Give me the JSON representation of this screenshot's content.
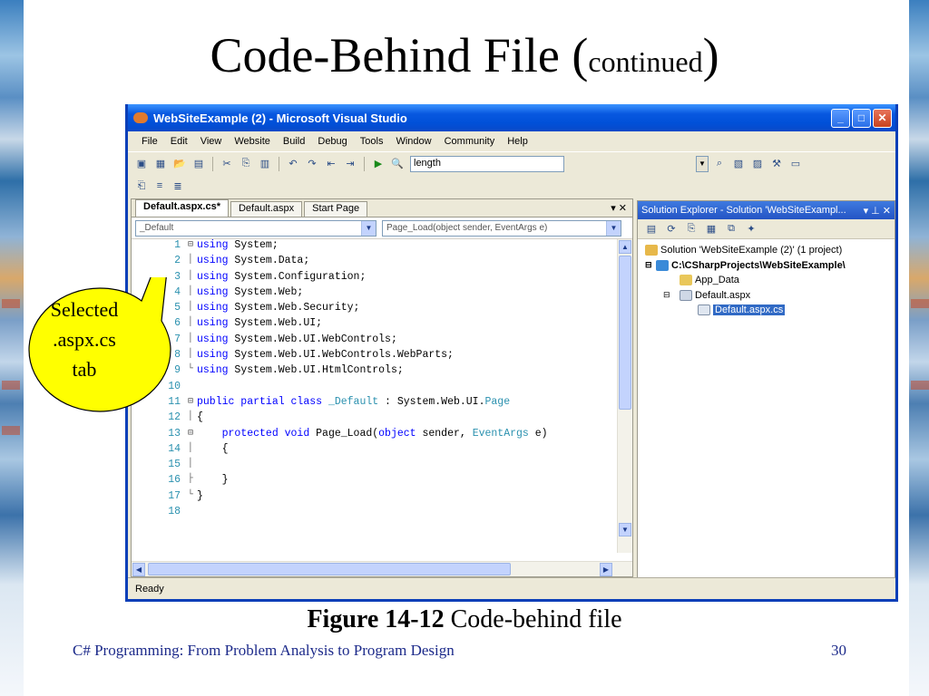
{
  "slide": {
    "title": "Code-Behind File (",
    "title_small": "continued",
    "title_close": ")",
    "caption_bold": "Figure 14-12",
    "caption_rest": " Code-behind file",
    "footer": "C# Programming: From Problem Analysis to Program Design",
    "page_number": "30",
    "callout": [
      "Selected",
      ".aspx.cs",
      "tab"
    ]
  },
  "window": {
    "title": "WebSiteExample (2) - Microsoft Visual Studio",
    "menu": [
      "File",
      "Edit",
      "View",
      "Website",
      "Build",
      "Debug",
      "Tools",
      "Window",
      "Community",
      "Help"
    ],
    "find_value": "length",
    "status": "Ready"
  },
  "editor": {
    "tabs": [
      "Default.aspx.cs*",
      "Default.aspx",
      "Start Page"
    ],
    "tab_controls": "▾ ✕",
    "class_dropdown": "_Default",
    "method_dropdown": "Page_Load(object sender, EventArgs e)",
    "line_numbers": [
      "1",
      "2",
      "3",
      "4",
      "5",
      "6",
      "7",
      "8",
      "9",
      "10",
      "11",
      "12",
      "13",
      "14",
      "15",
      "16",
      "17",
      "18"
    ]
  },
  "solution_explorer": {
    "title": "Solution Explorer - Solution 'WebSiteExampl...",
    "header_controls": "▾ ⊥ ✕",
    "items": [
      "Solution 'WebSiteExample (2)' (1 project)",
      "C:\\CSharpProjects\\WebSiteExample\\",
      "App_Data",
      "Default.aspx",
      "Default.aspx.cs"
    ]
  },
  "colors": {
    "keyword": "#0000ff",
    "type": "#2b91af",
    "titlebar": "#0858e0",
    "callout": "#ffff00"
  }
}
